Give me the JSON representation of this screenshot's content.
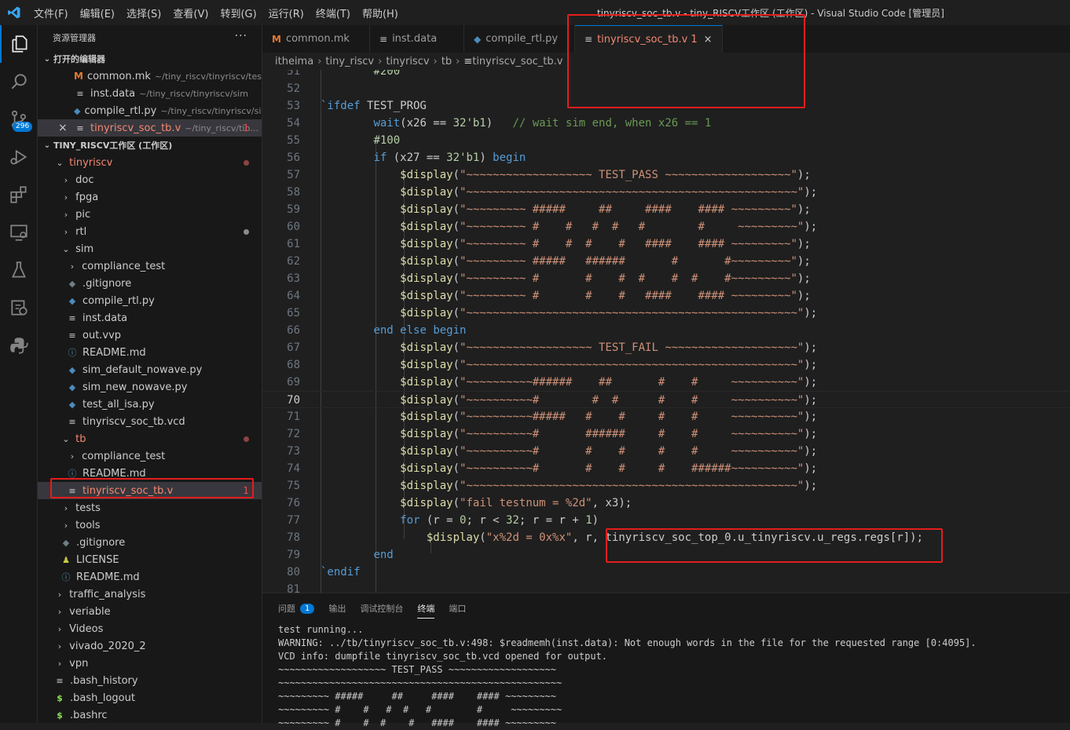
{
  "window": {
    "title": "tinyriscv_soc_tb.v - tiny_RISCV工作区 (工作区) - Visual Studio Code [管理员]",
    "menu": [
      "文件(F)",
      "编辑(E)",
      "选择(S)",
      "查看(V)",
      "转到(G)",
      "运行(R)",
      "终端(T)",
      "帮助(H)"
    ]
  },
  "activity_bar": {
    "items": [
      "explorer-icon",
      "search-icon",
      "source-control-icon",
      "run-debug-icon",
      "extensions-icon",
      "remote-explorer-icon",
      "testing-icon",
      "docker-icon",
      "python-icon"
    ],
    "scm_badge": "296"
  },
  "sidebar": {
    "title": "资源管理器",
    "more": "···",
    "open_editors_label": "打开的编辑器",
    "open_editors": [
      {
        "name": "common.mk",
        "path": "~/tiny_riscv/tinyriscv/test...",
        "icon": "makefile-icon"
      },
      {
        "name": "inst.data",
        "path": "~/tiny_riscv/tinyriscv/sim",
        "icon": "file-icon"
      },
      {
        "name": "compile_rtl.py",
        "path": "~/tiny_riscv/tinyriscv/sim",
        "icon": "python-icon"
      },
      {
        "name": "tinyriscv_soc_tb.v",
        "path": "~/tiny_riscv/tin...",
        "icon": "file-icon",
        "count": "1",
        "close": "×"
      }
    ],
    "workspace_label": "TINY_RISCV工作区 (工作区)",
    "tree": [
      {
        "name": "tinyriscv",
        "level": 1,
        "chev": "⌄",
        "error": true,
        "dot": true
      },
      {
        "name": "doc",
        "level": 2,
        "chev": "›"
      },
      {
        "name": "fpga",
        "level": 2,
        "chev": "›"
      },
      {
        "name": "pic",
        "level": 2,
        "chev": "›"
      },
      {
        "name": "rtl",
        "level": 2,
        "chev": "›",
        "dotgray": true
      },
      {
        "name": "sim",
        "level": 2,
        "chev": "⌄"
      },
      {
        "name": "compliance_test",
        "level": 3,
        "chev": "›"
      },
      {
        "name": ".gitignore",
        "level": 3,
        "icon": "git"
      },
      {
        "name": "compile_rtl.py",
        "level": 3,
        "icon": "py"
      },
      {
        "name": "inst.data",
        "level": 3,
        "icon": "txt"
      },
      {
        "name": "out.vvp",
        "level": 3,
        "icon": "txt"
      },
      {
        "name": "README.md",
        "level": 3,
        "icon": "info"
      },
      {
        "name": "sim_default_nowave.py",
        "level": 3,
        "icon": "py"
      },
      {
        "name": "sim_new_nowave.py",
        "level": 3,
        "icon": "py"
      },
      {
        "name": "test_all_isa.py",
        "level": 3,
        "icon": "py"
      },
      {
        "name": "tinyriscv_soc_tb.vcd",
        "level": 3,
        "icon": "txt"
      },
      {
        "name": "tb",
        "level": 2,
        "chev": "⌄",
        "error": true,
        "dot": true
      },
      {
        "name": "compliance_test",
        "level": 3,
        "chev": "›"
      },
      {
        "name": "README.md",
        "level": 3,
        "icon": "info"
      },
      {
        "name": "tinyriscv_soc_tb.v",
        "level": 3,
        "icon": "txt",
        "error": true,
        "selected": true,
        "count": "1"
      },
      {
        "name": "tests",
        "level": 2,
        "chev": "›"
      },
      {
        "name": "tools",
        "level": 2,
        "chev": "›"
      },
      {
        "name": ".gitignore",
        "level": 2,
        "icon": "git"
      },
      {
        "name": "LICENSE",
        "level": 2,
        "icon": "lic"
      },
      {
        "name": "README.md",
        "level": 2,
        "icon": "info"
      },
      {
        "name": "traffic_analysis",
        "level": 1,
        "chev": "›"
      },
      {
        "name": "veriable",
        "level": 1,
        "chev": "›"
      },
      {
        "name": "Videos",
        "level": 1,
        "chev": "›"
      },
      {
        "name": "vivado_2020_2",
        "level": 1,
        "chev": "›"
      },
      {
        "name": "vpn",
        "level": 1,
        "chev": "›"
      },
      {
        "name": ".bash_history",
        "level": 1,
        "icon": "txt"
      },
      {
        "name": ".bash_logout",
        "level": 1,
        "icon": "sh"
      },
      {
        "name": ".bashrc",
        "level": 1,
        "icon": "sh"
      }
    ]
  },
  "tabs": [
    {
      "label": "common.mk",
      "icon": "M"
    },
    {
      "label": "inst.data",
      "icon": "≡"
    },
    {
      "label": "compile_rtl.py",
      "icon": "py"
    },
    {
      "label": "tinyriscv_soc_tb.v",
      "icon": "≡",
      "count": "1",
      "close": "×",
      "active": true
    }
  ],
  "breadcrumb": [
    "itheima",
    "tiny_riscv",
    "tinyriscv",
    "tb",
    "tinyriscv_soc_tb.v"
  ],
  "editor": {
    "current_line": "70",
    "lines": [
      {
        "n": "51",
        "text": "        #200"
      },
      {
        "n": "52",
        "text": ""
      },
      {
        "n": "53",
        "text": "`ifdef TEST_PROG"
      },
      {
        "n": "54",
        "text": "        wait(x26 == 32'b1)   // wait sim end, when x26 == 1"
      },
      {
        "n": "55",
        "text": "        #100"
      },
      {
        "n": "56",
        "text": "        if (x27 == 32'b1) begin"
      },
      {
        "n": "57",
        "text": "            $display(\"~~~~~~~~~~~~~~~~~~~ TEST_PASS ~~~~~~~~~~~~~~~~~~~\");"
      },
      {
        "n": "58",
        "text": "            $display(\"~~~~~~~~~~~~~~~~~~~~~~~~~~~~~~~~~~~~~~~~~~~~~~~~~~\");"
      },
      {
        "n": "59",
        "text": "            $display(\"~~~~~~~~~ #####     ##     ####    #### ~~~~~~~~~\");"
      },
      {
        "n": "60",
        "text": "            $display(\"~~~~~~~~~ #    #   #  #   #        #     ~~~~~~~~~\");"
      },
      {
        "n": "61",
        "text": "            $display(\"~~~~~~~~~ #    #  #    #   ####    #### ~~~~~~~~~\");"
      },
      {
        "n": "62",
        "text": "            $display(\"~~~~~~~~~ #####   ######       #       #~~~~~~~~~\");"
      },
      {
        "n": "63",
        "text": "            $display(\"~~~~~~~~~ #       #    #  #    #  #    #~~~~~~~~~\");"
      },
      {
        "n": "64",
        "text": "            $display(\"~~~~~~~~~ #       #    #   ####    #### ~~~~~~~~~\");"
      },
      {
        "n": "65",
        "text": "            $display(\"~~~~~~~~~~~~~~~~~~~~~~~~~~~~~~~~~~~~~~~~~~~~~~~~~~\");"
      },
      {
        "n": "66",
        "text": "        end else begin"
      },
      {
        "n": "67",
        "text": "            $display(\"~~~~~~~~~~~~~~~~~~~ TEST_FAIL ~~~~~~~~~~~~~~~~~~~~\");"
      },
      {
        "n": "68",
        "text": "            $display(\"~~~~~~~~~~~~~~~~~~~~~~~~~~~~~~~~~~~~~~~~~~~~~~~~~~\");"
      },
      {
        "n": "69",
        "text": "            $display(\"~~~~~~~~~~######    ##       #    #     ~~~~~~~~~~\");"
      },
      {
        "n": "70",
        "text": "            $display(\"~~~~~~~~~~#        #  #      #    #     ~~~~~~~~~~\");"
      },
      {
        "n": "71",
        "text": "            $display(\"~~~~~~~~~~#####   #    #     #    #     ~~~~~~~~~~\");"
      },
      {
        "n": "72",
        "text": "            $display(\"~~~~~~~~~~#       ######     #    #     ~~~~~~~~~~\");"
      },
      {
        "n": "73",
        "text": "            $display(\"~~~~~~~~~~#       #    #     #    #     ~~~~~~~~~~\");"
      },
      {
        "n": "74",
        "text": "            $display(\"~~~~~~~~~~#       #    #     #    ######~~~~~~~~~~\");"
      },
      {
        "n": "75",
        "text": "            $display(\"~~~~~~~~~~~~~~~~~~~~~~~~~~~~~~~~~~~~~~~~~~~~~~~~~~\");"
      },
      {
        "n": "76",
        "text": "            $display(\"fail testnum = %2d\", x3);"
      },
      {
        "n": "77",
        "text": "            for (r = 0; r < 32; r = r + 1)"
      },
      {
        "n": "78",
        "text": "                $display(\"x%2d = 0x%x\", r, tinyriscv_soc_top_0.u_tinyriscv.u_regs.regs[r]);"
      },
      {
        "n": "79",
        "text": "        end"
      },
      {
        "n": "80",
        "text": "`endif"
      },
      {
        "n": "81",
        "text": ""
      }
    ]
  },
  "panel": {
    "tabs": [
      {
        "label": "问题",
        "badge": "1"
      },
      {
        "label": "输出"
      },
      {
        "label": "调试控制台"
      },
      {
        "label": "终端",
        "active": true
      },
      {
        "label": "端口"
      }
    ],
    "terminal_lines": [
      "test running...",
      "WARNING: ../tb/tinyriscv_soc_tb.v:498: $readmemh(inst.data): Not enough words in the file for the requested range [0:4095].",
      "VCD info: dumpfile tinyriscv_soc_tb.vcd opened for output.",
      "~~~~~~~~~~~~~~~~~~~ TEST_PASS ~~~~~~~~~~~~~~~~~~~",
      "~~~~~~~~~~~~~~~~~~~~~~~~~~~~~~~~~~~~~~~~~~~~~~~~~~",
      "~~~~~~~~~ #####     ##     ####    #### ~~~~~~~~~",
      "~~~~~~~~~ #    #   #  #   #        #     ~~~~~~~~~",
      "~~~~~~~~~ #    #  #    #   ####    #### ~~~~~~~~~"
    ]
  },
  "colors": {
    "accent": "#0078d4",
    "highlight_box": "#e51d1d",
    "error": "#f48771",
    "keyword": "#569cd6",
    "string": "#ce9178",
    "comment": "#6a9955",
    "function": "#dcdcaa",
    "number": "#b5cea8"
  }
}
